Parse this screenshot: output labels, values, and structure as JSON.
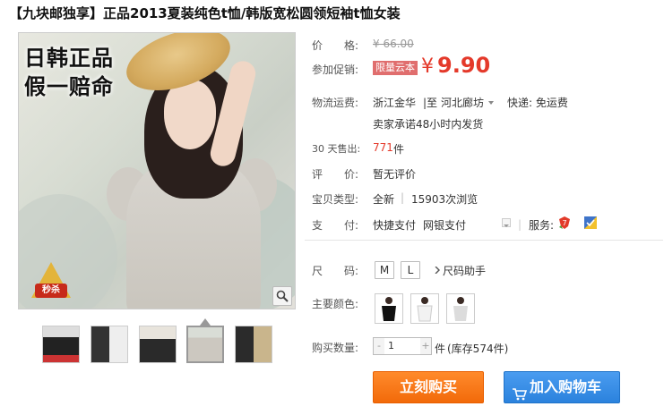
{
  "title": "【九块邮独享】正品2013夏装纯色t恤/韩版宽松圆领短袖t恤女装",
  "image": {
    "promo_line1": "日韩正品",
    "promo_line2": "假一赔命",
    "tag_text": "秒杀"
  },
  "price": {
    "label": "价　　格:",
    "original": "¥ 66.00"
  },
  "promo": {
    "label": "参加促销:",
    "badge": "限量云本",
    "price": "9.90",
    "yen": "¥"
  },
  "shipping": {
    "label": "物流运费:",
    "from": "浙江金华",
    "sep": "|至",
    "to": "河北廊坊",
    "express": "快递: 免运费",
    "promise": "卖家承诺48小时内发货"
  },
  "sales": {
    "label": "30 天售出:",
    "count": "771",
    "unit": "件"
  },
  "review": {
    "label": "评　　价:",
    "value": "暂无评价"
  },
  "type": {
    "label": "宝贝类型:",
    "value": "全新",
    "views": "15903次浏览"
  },
  "pay": {
    "label": "支　　付:",
    "method1": "快捷支付",
    "method2": "网银支付",
    "service_label": "服务:"
  },
  "size": {
    "label": "尺　　码:",
    "options": [
      "M",
      "L"
    ],
    "helper": "尺码助手"
  },
  "color": {
    "label": "主要颜色:"
  },
  "quantity": {
    "label": "购买数量:",
    "minus": "-",
    "value": "1",
    "plus": "+",
    "unit": "件",
    "stock": "(库存574件)"
  },
  "actions": {
    "buy": "立刻购买",
    "cart": "加入购物车"
  },
  "colors": {
    "accent": "#e4392a",
    "buy": "#f26a0a",
    "cart": "#2b82dd",
    "badge": "#e06e6e"
  }
}
